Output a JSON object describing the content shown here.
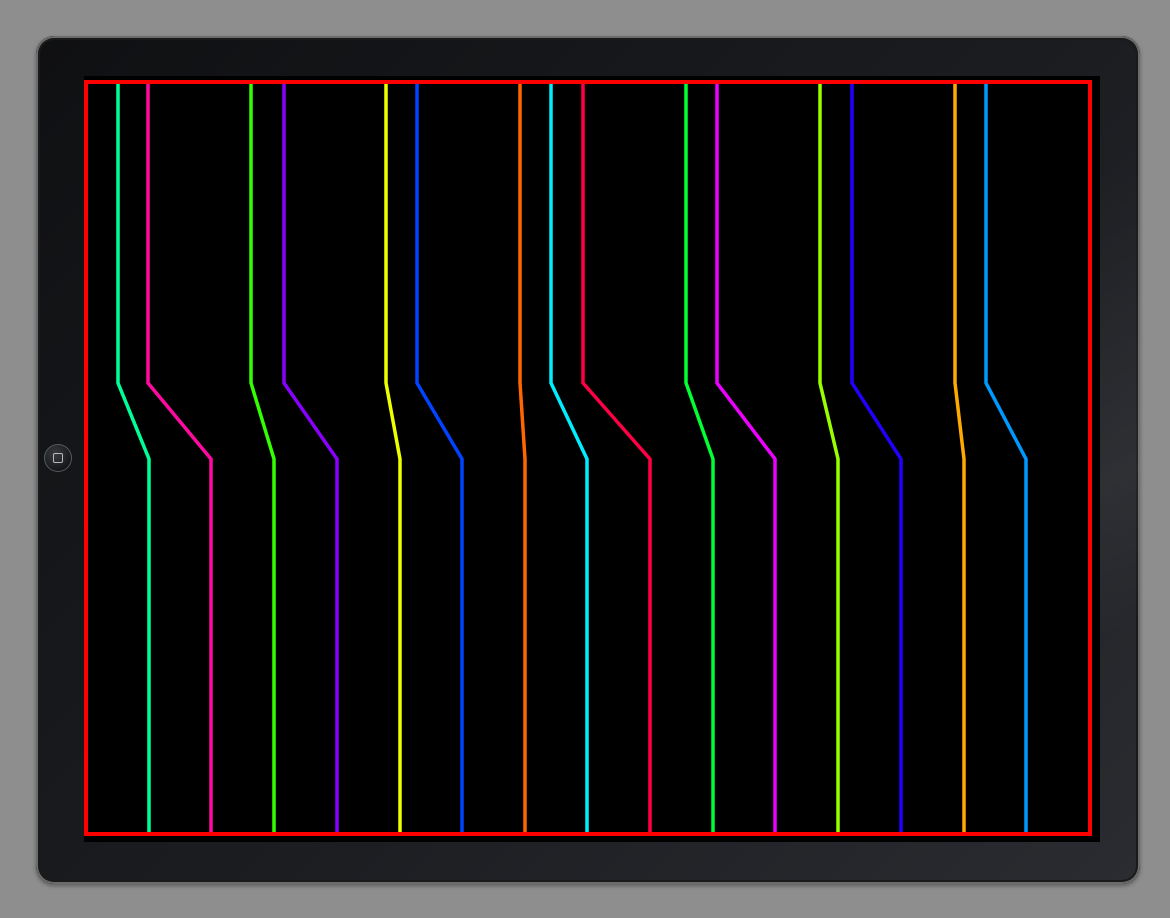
{
  "device": {
    "type": "tablet",
    "home_button_icon": "home-square-icon"
  },
  "scene": {
    "background": "#000000",
    "border_color": "#ff0000",
    "line_colors": [
      "#00ff99",
      "#ff0aa0",
      "#33ff00",
      "#8a00ff",
      "#eeff00",
      "#0044ff",
      "#ff6600",
      "#00eeff",
      "#ff0044",
      "#00ff33",
      "#ee00ff",
      "#99ff00",
      "#2200ff",
      "#ffaa00",
      "#0099ff"
    ]
  }
}
